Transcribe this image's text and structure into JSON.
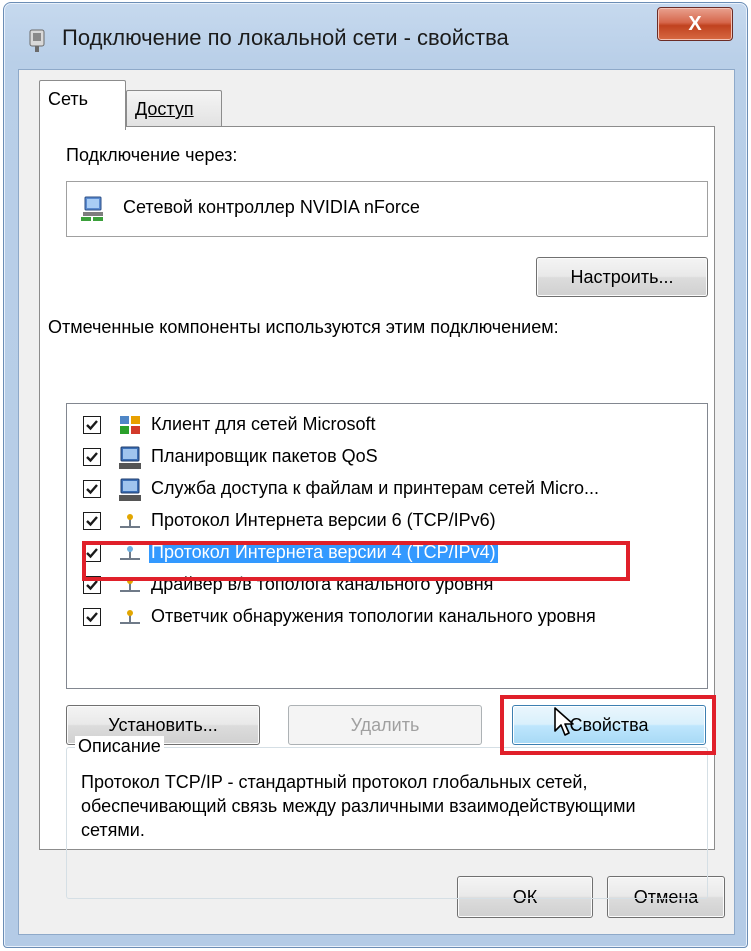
{
  "window": {
    "title": "Подключение по локальной сети - свойства",
    "close_label": "X"
  },
  "tabs": [
    {
      "label": "Сеть",
      "active": true
    },
    {
      "label": "Доступ",
      "active": false
    }
  ],
  "connection": {
    "label": "Подключение через:",
    "adapter_name": "Сетевой контроллер NVIDIA nForce",
    "configure_label": "Настроить..."
  },
  "components": {
    "label": "Отмеченные компоненты используются этим подключением:",
    "items": [
      {
        "label": "Клиент для сетей Microsoft",
        "checked": true,
        "icon": "network-client-icon",
        "selected": false
      },
      {
        "label": "Планировщик пакетов QoS",
        "checked": true,
        "icon": "computer-service-icon",
        "selected": false
      },
      {
        "label": "Служба доступа к файлам и принтерам сетей Micro...",
        "checked": true,
        "icon": "computer-service-icon",
        "selected": false
      },
      {
        "label": "Протокол Интернета версии 6 (TCP/IPv6)",
        "checked": true,
        "icon": "protocol-icon",
        "selected": false
      },
      {
        "label": "Протокол Интернета версии 4 (TCP/IPv4)",
        "checked": true,
        "icon": "protocol-icon",
        "selected": true
      },
      {
        "label": "Драйвер в/в тополога канального уровня",
        "checked": true,
        "icon": "protocol-icon",
        "selected": false
      },
      {
        "label": "Ответчик обнаружения топологии канального уровня",
        "checked": true,
        "icon": "protocol-icon",
        "selected": false
      }
    ]
  },
  "actions": {
    "install_label": "Установить...",
    "remove_label": "Удалить",
    "properties_label": "Свойства"
  },
  "description": {
    "legend": "Описание",
    "text": "Протокол TCP/IP - стандартный протокол глобальных сетей, обеспечивающий связь между различными взаимодействующими сетями."
  },
  "footer": {
    "ok_label": "ОК",
    "cancel_label": "Отмена"
  },
  "colors": {
    "selection": "#3399ff",
    "highlight_frame": "#e0202a",
    "title_bar": "#b9cfe8"
  }
}
